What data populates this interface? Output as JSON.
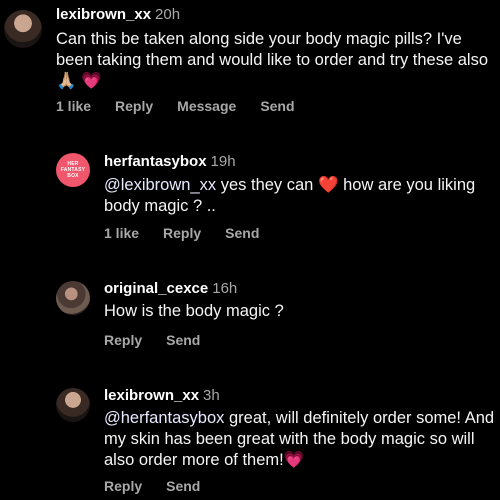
{
  "comments": [
    {
      "username": "lexibrown_xx",
      "time": "20h",
      "text": "Can this be taken along side your body magic pills? I've been taking them and would like to order and try these also",
      "emoji": [
        "🙏🏼",
        "💗"
      ],
      "actions": {
        "likes": "1 like",
        "reply": "Reply",
        "message": "Message",
        "send": "Send"
      }
    },
    {
      "username": "herfantasybox",
      "time": "19h",
      "avatar_text": [
        "HER",
        "FANTASY",
        "BOX"
      ],
      "mention": "@lexibrown_xx",
      "text_before_emoji": "yes they can",
      "emoji": "❤️",
      "text_after_emoji": "how are you liking body magic ? ..",
      "actions": {
        "likes": "1 like",
        "reply": "Reply",
        "send": "Send"
      }
    },
    {
      "username": "original_cexce",
      "time": "16h",
      "text": "How is the body magic ?",
      "actions": {
        "reply": "Reply",
        "send": "Send"
      }
    },
    {
      "username": "lexibrown_xx",
      "time": "3h",
      "mention": "@herfantasybox",
      "text": "great, will definitely order some! And my skin has been great with the body magic so will also order more of them!",
      "emoji": "💗",
      "actions": {
        "reply": "Reply",
        "send": "Send"
      }
    }
  ]
}
